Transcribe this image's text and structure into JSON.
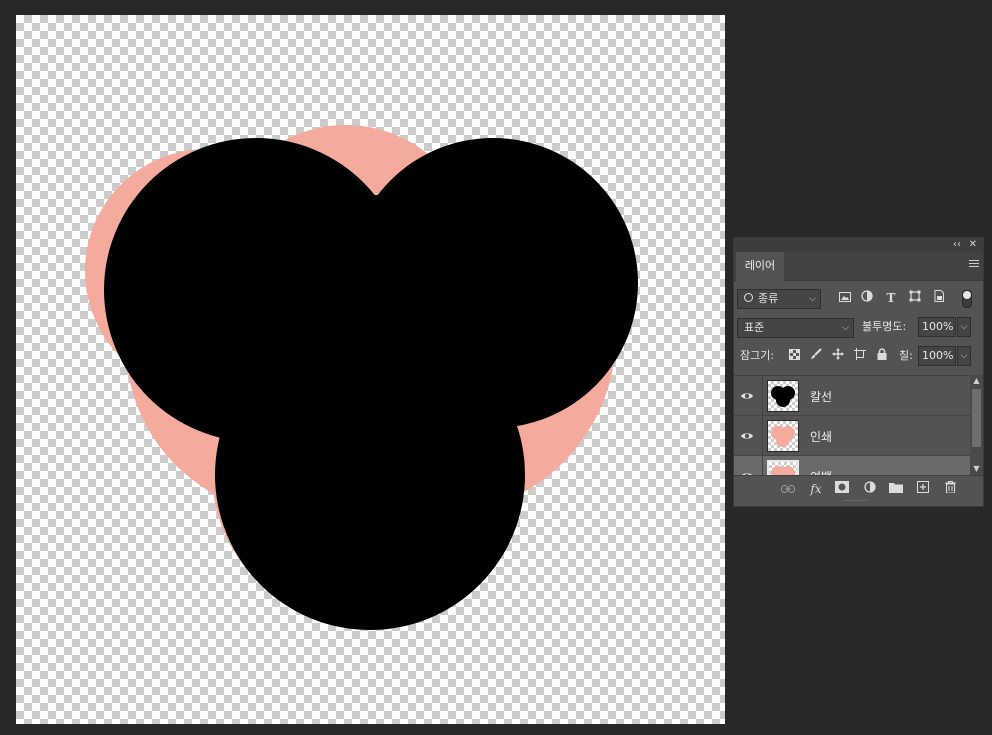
{
  "canvas": {
    "shape_fill": "#000000",
    "shape_outline": "#f4aa9c"
  },
  "panel": {
    "tab_label": "레이어",
    "collapse_label": "‹‹",
    "close_label": "✕",
    "filter": {
      "label": "종류",
      "icons": [
        "image-filter-icon",
        "adjustment-filter-icon",
        "type-filter-icon",
        "shape-filter-icon",
        "smart-object-filter-icon"
      ]
    },
    "blend_mode": "표준",
    "opacity_label": "불투명도:",
    "opacity_value": "100%",
    "lock_label": "잠그기:",
    "fill_label": "칠:",
    "fill_value": "100%",
    "layers": [
      {
        "name": "칼선",
        "visible": true,
        "thumb": "black-shape"
      },
      {
        "name": "인쇄",
        "visible": true,
        "thumb": "pink-heart"
      },
      {
        "name": "여백",
        "visible": true,
        "thumb": "pink-outline",
        "selected": true
      }
    ],
    "bottom_icons": [
      "link-icon",
      "fx-icon",
      "mask-icon",
      "adjustment-icon",
      "folder-icon",
      "new-layer-icon",
      "trash-icon"
    ]
  }
}
